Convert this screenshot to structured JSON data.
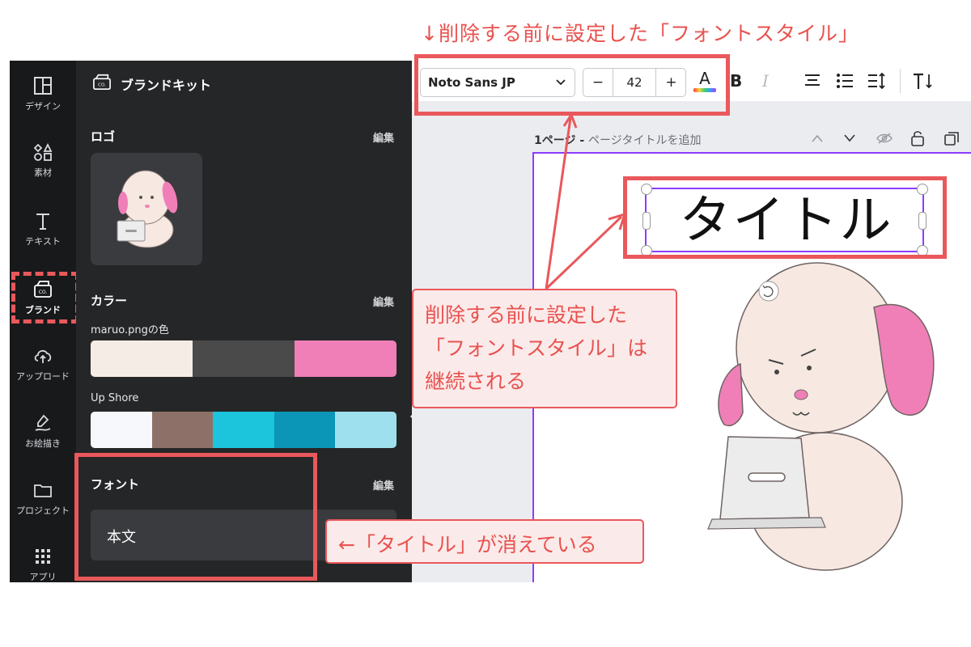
{
  "annotations": {
    "top_note": "↓削除する前に設定した「フォントスタイル」",
    "middle_note_lines": [
      "削除する前に設定した",
      "「フォントスタイル」は",
      "継続される"
    ],
    "bottom_note": "←「タイトル」が消えている"
  },
  "rail": {
    "items": [
      {
        "label": "デザイン",
        "icon": "layout-icon"
      },
      {
        "label": "素材",
        "icon": "shapes-icon"
      },
      {
        "label": "テキスト",
        "icon": "text-icon"
      },
      {
        "label": "ブランド",
        "icon": "brand-kit-icon"
      },
      {
        "label": "アップロード",
        "icon": "cloud-upload-icon"
      },
      {
        "label": "お絵描き",
        "icon": "draw-icon"
      },
      {
        "label": "プロジェクト",
        "icon": "folder-icon"
      },
      {
        "label": "アプリ",
        "icon": "apps-grid-icon"
      }
    ]
  },
  "panel": {
    "header": "ブランドキット",
    "logo": {
      "title": "ロゴ",
      "edit": "編集"
    },
    "colors": {
      "title": "カラー",
      "edit": "編集",
      "palettes": [
        {
          "name": "maruo.pngの色",
          "colors": [
            "#f6ece6",
            "#4a4a4a",
            "#f07fb8"
          ]
        },
        {
          "name": "Up Shore",
          "colors": [
            "#f7f8fc",
            "#8d7168",
            "#1cc5dc",
            "#0b95b6",
            "#9fe0ee"
          ]
        }
      ]
    },
    "fonts": {
      "title": "フォント",
      "edit": "編集",
      "body_label": "本文"
    }
  },
  "toolbar": {
    "font_family": "Noto Sans JP",
    "font_size": "42",
    "minus": "−",
    "plus": "+",
    "text_color_letter": "A",
    "bold": "B",
    "italic": "I"
  },
  "canvas": {
    "page_label": "1ページ - ",
    "page_title_placeholder": "ページタイトルを追加",
    "title_text": "タイトル"
  },
  "colors": {
    "accent_red": "#e9585b",
    "selection_purple": "#8b3dff"
  }
}
